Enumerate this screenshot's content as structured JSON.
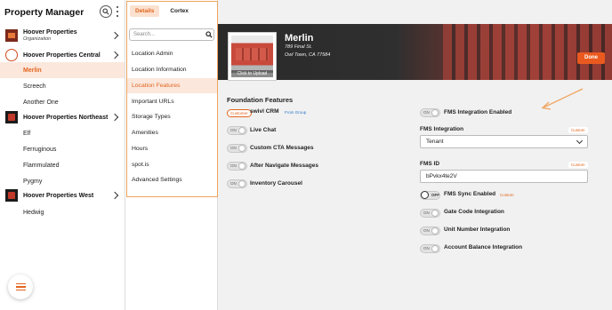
{
  "app": {
    "title": "Property Manager"
  },
  "tree": {
    "orgs": [
      {
        "name": "Hoover Properties",
        "sub": "Organization"
      },
      {
        "name": "Hoover Properties Central",
        "sub": ""
      },
      {
        "name": "Hoover Properties Northeast",
        "sub": ""
      },
      {
        "name": "Hoover Properties West",
        "sub": ""
      }
    ],
    "locations": [
      "Merlin",
      "Screech",
      "Another One",
      "Elf",
      "Ferruginous",
      "Flammulated",
      "Pygmy",
      "Hedwig"
    ],
    "active_location": "Merlin"
  },
  "menu": {
    "tabs": [
      "Details",
      "Cortex"
    ],
    "active_tab": "Details",
    "search_placeholder": "Search...",
    "items": [
      "Location Admin",
      "Location Information",
      "Location Features",
      "Important URLs",
      "Storage Types",
      "Amenities",
      "Hours",
      "spot.is",
      "Advanced Settings"
    ],
    "active_item": "Location Features"
  },
  "header": {
    "thumbnail_caption": "Click to Upload",
    "location_name": "Merlin",
    "street": "789 Final St.",
    "city": "Owl Town, CA 77584",
    "done_label": "Done"
  },
  "features": {
    "section_title": "Foundation Features",
    "customer_pill": "Customer",
    "swivl_label": "swivl CRM",
    "from_group": "From Group",
    "left_rows": [
      {
        "label": "Live Chat",
        "state": "ON"
      },
      {
        "label": "Custom CTA Messages",
        "state": "ON"
      },
      {
        "label": "After Navigate Messages",
        "state": "ON"
      },
      {
        "label": "Inventory Carousel",
        "state": "ON"
      }
    ],
    "fms_integration_enabled": {
      "label": "FMS Integration Enabled",
      "state": "ON"
    },
    "fms_integration": {
      "label": "FMS Integration",
      "badge": "Custom",
      "value": "Tenant"
    },
    "fms_id": {
      "label": "FMS ID",
      "badge": "Custom",
      "value": "bPvkx4te2V"
    },
    "fms_sync": {
      "label": "FMS Sync Enabled",
      "state": "OFF",
      "badge": "Custom"
    },
    "right_rows": [
      {
        "label": "Gate Code Integration",
        "state": "ON"
      },
      {
        "label": "Unit Number Integration",
        "state": "ON"
      },
      {
        "label": "Account Balance Integration",
        "state": "ON"
      }
    ]
  },
  "colors": {
    "accent": "#ea5a1f",
    "highlight_bg": "#fbe7dc",
    "focus_outline": "#f0a45e"
  }
}
